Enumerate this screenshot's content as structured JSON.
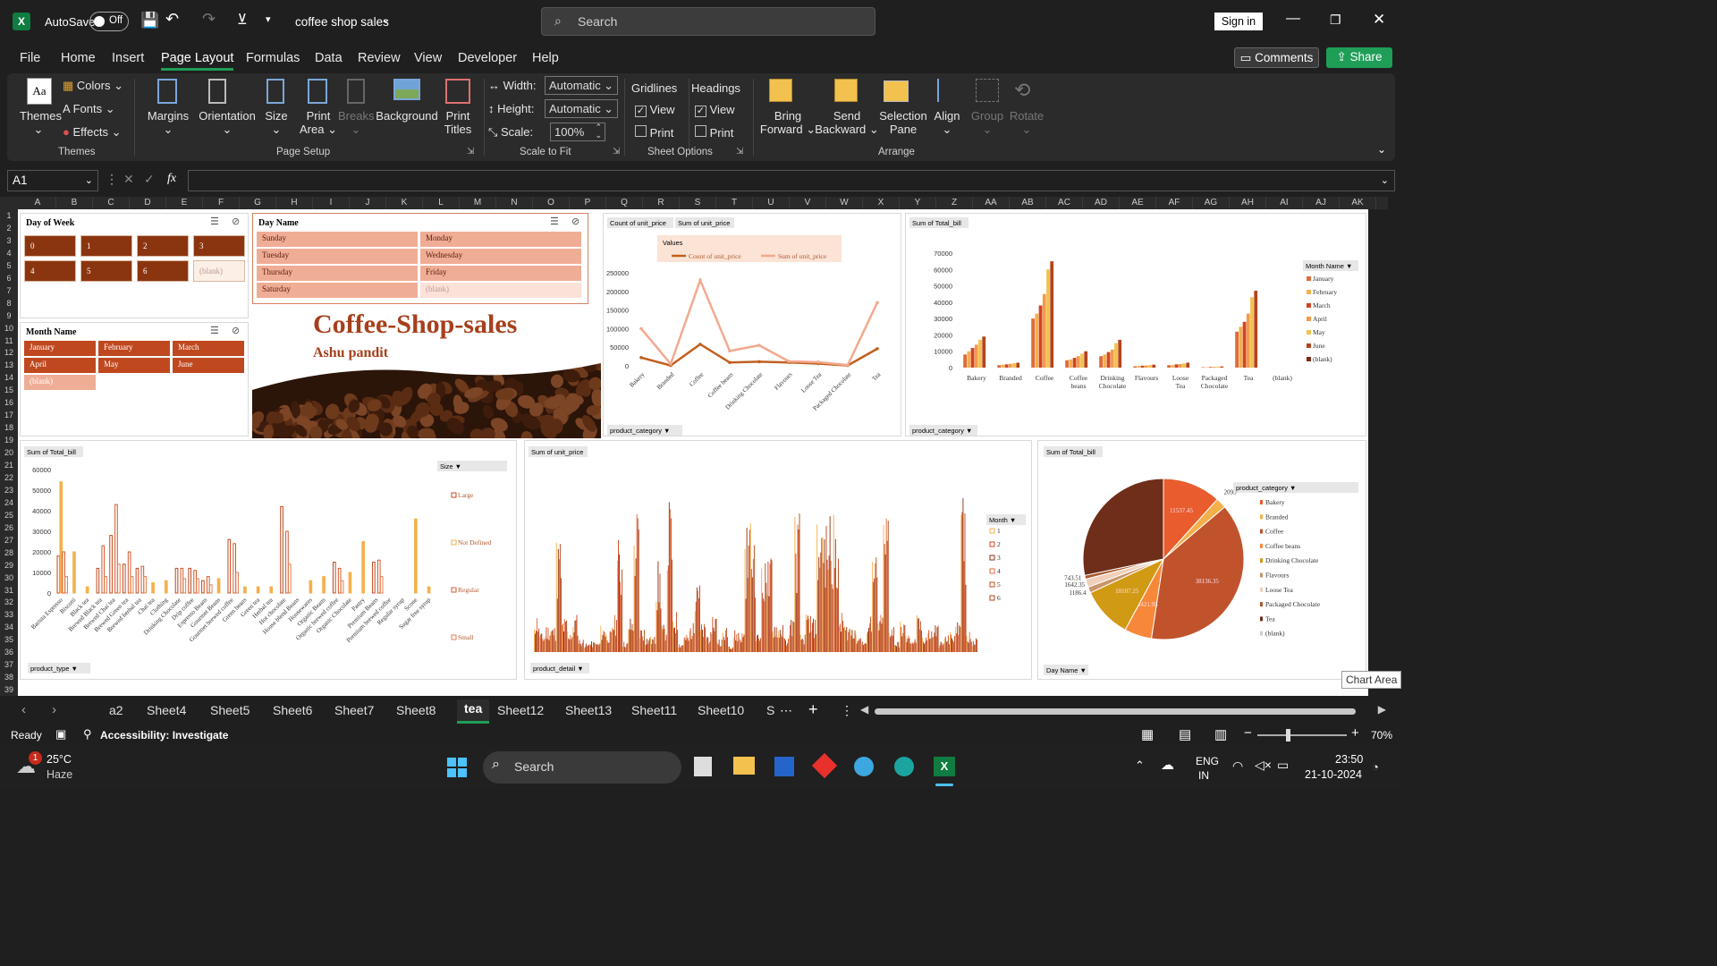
{
  "titlebar": {
    "app_badge": "X",
    "autosave_label": "AutoSave",
    "autosave_state": "Off",
    "doc_title": "coffee shop sales",
    "search_placeholder": "Search",
    "signin_label": "Sign in"
  },
  "menu": {
    "items": [
      "File",
      "Home",
      "Insert",
      "Page Layout",
      "Formulas",
      "Data",
      "Review",
      "View",
      "Developer",
      "Help"
    ],
    "active": "Page Layout",
    "comments_label": "Comments",
    "share_label": "Share"
  },
  "ribbon": {
    "themes": {
      "themes_label": "Themes",
      "colors_label": "Colors",
      "fonts_label": "Fonts",
      "effects_label": "Effects",
      "group_label": "Themes"
    },
    "page_setup": {
      "margins": "Margins",
      "orientation": "Orientation",
      "size": "Size",
      "print_area": "Print Area",
      "breaks": "Breaks",
      "background": "Background",
      "print_titles": "Print Titles",
      "group_label": "Page Setup"
    },
    "scale": {
      "width_label": "Width:",
      "width_value": "Automatic",
      "height_label": "Height:",
      "height_value": "Automatic",
      "scale_label": "Scale:",
      "scale_value": "100%",
      "group_label": "Scale to Fit"
    },
    "sheet_options": {
      "gridlines": "Gridlines",
      "headings": "Headings",
      "view": "View",
      "print": "Print",
      "group_label": "Sheet Options"
    },
    "arrange": {
      "bring_forward": "Bring Forward",
      "send_backward": "Send Backward",
      "selection_pane": "Selection Pane",
      "align": "Align",
      "group": "Group",
      "rotate": "Rotate",
      "group_label": "Arrange"
    }
  },
  "formula_bar": {
    "name_box": "A1",
    "fx": "fx",
    "value": ""
  },
  "columns": [
    "A",
    "B",
    "C",
    "D",
    "E",
    "F",
    "G",
    "H",
    "I",
    "J",
    "K",
    "L",
    "M",
    "N",
    "O",
    "P",
    "Q",
    "R",
    "S",
    "T",
    "U",
    "V",
    "W",
    "X",
    "Y",
    "Z",
    "AA",
    "AB",
    "AC",
    "AD",
    "AE",
    "AF",
    "AG",
    "AH",
    "AI",
    "AJ",
    "AK"
  ],
  "rows": [
    "1",
    "2",
    "3",
    "4",
    "5",
    "6",
    "7",
    "8",
    "9",
    "10",
    "11",
    "12",
    "13",
    "14",
    "15",
    "16",
    "17",
    "18",
    "19",
    "20",
    "21",
    "22",
    "23",
    "24",
    "25",
    "26",
    "27",
    "28",
    "29",
    "30",
    "31",
    "32",
    "33",
    "34",
    "35",
    "36",
    "37",
    "38",
    "39"
  ],
  "slicers": {
    "day_of_week": {
      "title": "Day of Week",
      "items": [
        "0",
        "1",
        "2",
        "3",
        "4",
        "5",
        "6",
        "(blank)"
      ]
    },
    "day_name": {
      "title": "Day Name",
      "items": [
        "Sunday",
        "Monday",
        "Tuesday",
        "Wednesday",
        "Thursday",
        "Friday",
        "Saturday",
        "(blank)"
      ]
    },
    "month_name": {
      "title": "Month Name",
      "items": [
        "January",
        "February",
        "March",
        "April",
        "May",
        "June",
        "(blank)"
      ]
    }
  },
  "banner": {
    "title": "Coffee-Shop-sales",
    "subtitle": "Ashu pandit"
  },
  "chart_data": [
    {
      "type": "line",
      "field_buttons": [
        "Count of unit_price",
        "Sum of unit_price"
      ],
      "legend_title": "Values",
      "axis_field": "product_category",
      "categories": [
        "Bakery",
        "Branded",
        "Coffee",
        "Coffee beans",
        "Drinking Chocolate",
        "Flavours",
        "Loose Tea",
        "Packaged Chocolate",
        "Tea"
      ],
      "series": [
        {
          "name": "Count of unit_price",
          "values": [
            22000,
            1000,
            58000,
            9000,
            11000,
            9000,
            6000,
            1000,
            46000
          ],
          "color": "#c0601e"
        },
        {
          "name": "Sum of unit_price",
          "values": [
            100000,
            5000,
            230000,
            40000,
            55000,
            12000,
            10000,
            2000,
            170000
          ],
          "color": "#f2a98e"
        }
      ],
      "ylim": [
        0,
        250000
      ],
      "yticks": [
        "250000",
        "200000",
        "150000",
        "100000",
        "50000",
        "0"
      ]
    },
    {
      "type": "bar",
      "field_button": "Sum of Total_bill",
      "legend_title": "Month Name",
      "axis_field": "product_category",
      "categories": [
        "Bakery",
        "Branded",
        "Coffee",
        "Coffee beans",
        "Drinking Chocolate",
        "Flavours",
        "Loose Tea",
        "Packaged Chocolate",
        "Tea",
        "(blank)"
      ],
      "series": [
        {
          "name": "January",
          "values": [
            8000,
            1500,
            30000,
            4500,
            7000,
            800,
            1500,
            300,
            22000,
            0
          ]
        },
        {
          "name": "February",
          "values": [
            10000,
            1800,
            33000,
            5000,
            8000,
            1000,
            1600,
            300,
            25000,
            0
          ]
        },
        {
          "name": "March",
          "values": [
            12000,
            2000,
            38000,
            6000,
            9500,
            1200,
            2000,
            400,
            28000,
            0
          ]
        },
        {
          "name": "April",
          "values": [
            14000,
            2300,
            45000,
            7000,
            11000,
            1300,
            2200,
            500,
            33000,
            0
          ]
        },
        {
          "name": "May",
          "values": [
            17000,
            2700,
            60000,
            8500,
            15000,
            1600,
            2600,
            600,
            43000,
            0
          ]
        },
        {
          "name": "June",
          "values": [
            19000,
            3000,
            65000,
            10000,
            17000,
            1800,
            3000,
            700,
            47000,
            0
          ]
        },
        {
          "name": "(blank)",
          "values": [
            0,
            0,
            0,
            0,
            0,
            0,
            0,
            0,
            0,
            0
          ]
        }
      ],
      "ylim": [
        0,
        70000
      ],
      "yticks": [
        "70000",
        "60000",
        "50000",
        "40000",
        "30000",
        "20000",
        "10000",
        "0"
      ]
    },
    {
      "type": "bar",
      "field_button": "Sum of Total_bill",
      "legend_title": "Size",
      "axis_field": "product_type",
      "categories": [
        "Barista Espresso",
        "Biscotti",
        "Black tea",
        "Brewed Black tea",
        "Brewed Chai tea",
        "Brewed Green tea",
        "Brewed herbal tea",
        "Chai tea",
        "Clothing",
        "Drinking Chocolate",
        "Drip coffee",
        "Espresso Beans",
        "Gourmet Beans",
        "Gourmet brewed coffee",
        "Green beans",
        "Green tea",
        "Herbal tea",
        "Hot chocolate",
        "House blend Beans",
        "Housewares",
        "Organic Beans",
        "Organic brewed coffee",
        "Organic Chocolate",
        "Pastry",
        "Premium Beans",
        "Premium brewed coffee",
        "Regular syrup",
        "Scone",
        "Sugar free syrup"
      ],
      "series": [
        {
          "name": "Large",
          "values": [
            18000,
            0,
            0,
            12000,
            28000,
            14000,
            12000,
            0,
            0,
            12000,
            12000,
            6000,
            0,
            26000,
            0,
            0,
            0,
            42000,
            0,
            0,
            0,
            15000,
            0,
            0,
            15000,
            0,
            0,
            0,
            0
          ]
        },
        {
          "name": "Not Defined",
          "values": [
            54000,
            20000,
            3000,
            0,
            0,
            0,
            0,
            5000,
            6000,
            0,
            0,
            0,
            7000,
            0,
            3000,
            3000,
            3000,
            0,
            0,
            6000,
            8000,
            0,
            10000,
            25000,
            0,
            0,
            0,
            36000,
            3000
          ]
        },
        {
          "name": "Regular",
          "values": [
            20000,
            0,
            0,
            23000,
            43000,
            20000,
            13000,
            0,
            0,
            12000,
            11000,
            8000,
            0,
            24000,
            0,
            0,
            0,
            30000,
            0,
            0,
            0,
            12000,
            0,
            0,
            16000,
            0,
            0,
            0,
            0
          ]
        },
        {
          "name": "Small",
          "values": [
            8000,
            0,
            0,
            8000,
            14000,
            8000,
            8000,
            0,
            0,
            7000,
            7000,
            4000,
            0,
            10000,
            0,
            0,
            0,
            14000,
            0,
            0,
            0,
            6000,
            0,
            0,
            8000,
            0,
            0,
            0,
            0
          ]
        }
      ],
      "ylim": [
        0,
        60000
      ],
      "yticks": [
        "60000",
        "50000",
        "40000",
        "30000",
        "20000",
        "10000",
        "0"
      ]
    },
    {
      "type": "bar",
      "field_button": "Sum of unit_price",
      "legend_title": "Month",
      "axis_field": "product_detail",
      "series": [
        {
          "name": "1"
        },
        {
          "name": "2"
        },
        {
          "name": "3"
        },
        {
          "name": "4"
        },
        {
          "name": "5"
        },
        {
          "name": "6"
        }
      ]
    },
    {
      "type": "pie",
      "field_button": "Sum of Total_bill",
      "legend_title": "product_category",
      "axis_field": "Day Name",
      "slices": [
        {
          "name": "Bakery",
          "value": 11537.45,
          "color": "#e85c2e"
        },
        {
          "name": "Branded",
          "value": 2093,
          "color": "#f5b04a"
        },
        {
          "name": "Coffee",
          "value": 38136.35,
          "color": "#c0532c"
        },
        {
          "name": "Coffee beans",
          "value": 5421.95,
          "color": "#f7883a"
        },
        {
          "name": "Drinking Chocolate",
          "value": 10107.25,
          "color": "#d19a14"
        },
        {
          "name": "Flavours",
          "value": 1186.4,
          "color": "#c9956a"
        },
        {
          "name": "Loose Tea",
          "value": 1642.35,
          "color": "#f0d0bb"
        },
        {
          "name": "Packaged Chocolate",
          "value": 743.51,
          "color": "#a85a30"
        },
        {
          "name": "Tea",
          "value": 27920,
          "color": "#6e2e1a"
        },
        {
          "name": "(blank)",
          "value": 0,
          "color": "#cccccc"
        }
      ],
      "labels": [
        "11537.45",
        "2093",
        "38136.35",
        "5421.95",
        "10107.25",
        "1186.4",
        "1642.35",
        "743.51"
      ]
    }
  ],
  "tooltip": "Chart Area",
  "sheet_tabs": {
    "items": [
      "a2",
      "Sheet4",
      "Sheet5",
      "Sheet6",
      "Sheet7",
      "Sheet8",
      "tea",
      "Sheet12",
      "Sheet13",
      "Sheet11",
      "Sheet10",
      "S"
    ],
    "active": "tea"
  },
  "status": {
    "ready": "Ready",
    "accessibility": "Accessibility: Investigate",
    "zoom": "70%"
  },
  "taskbar": {
    "temp": "25°C",
    "weather": "Haze",
    "badge": "1",
    "search": "Search",
    "lang1": "ENG",
    "lang2": "IN",
    "time": "23:50",
    "date": "21-10-2024"
  }
}
